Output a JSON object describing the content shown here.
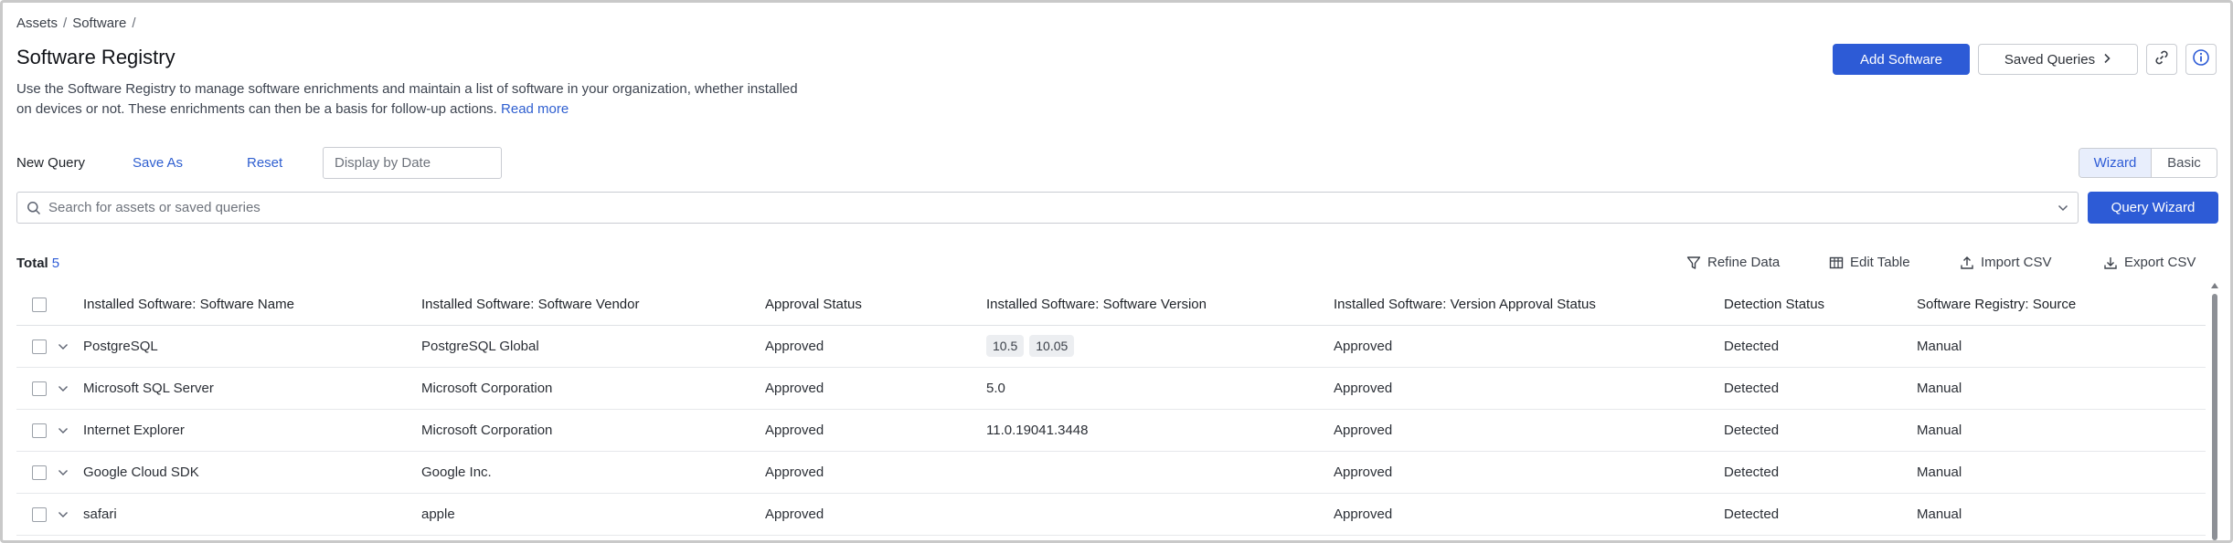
{
  "breadcrumb": {
    "items": [
      "Assets",
      "Software"
    ],
    "separator": "/"
  },
  "page": {
    "title": "Software Registry",
    "description": "Use the Software Registry to manage software enrichments and maintain a list of software in your organization, whether installed on devices or not. These enrichments can then be a basis for follow-up actions.",
    "read_more": "Read more"
  },
  "header_actions": {
    "add_software": "Add Software",
    "saved_queries": "Saved Queries",
    "link_icon": "link-icon",
    "info_icon": "info-icon"
  },
  "query_bar": {
    "new_query": "New Query",
    "save_as": "Save As",
    "reset": "Reset",
    "date_placeholder": "Display by Date",
    "mode_wizard": "Wizard",
    "mode_basic": "Basic",
    "active_mode": "Wizard"
  },
  "search": {
    "placeholder": "Search for assets or saved queries",
    "query_wizard": "Query Wizard"
  },
  "results": {
    "total_label": "Total",
    "total_count": "5"
  },
  "toolbar": {
    "refine_data": "Refine Data",
    "edit_table": "Edit Table",
    "import_csv": "Import CSV",
    "export_csv": "Export CSV"
  },
  "table": {
    "columns": [
      "Installed Software: Software Name",
      "Installed Software: Software Vendor",
      "Approval Status",
      "Installed Software: Software Version",
      "Installed Software: Version Approval Status",
      "Detection Status",
      "Software Registry: Source"
    ],
    "rows": [
      {
        "name": "PostgreSQL",
        "vendor": "PostgreSQL Global",
        "approval": "Approved",
        "versions": [
          "10.5",
          "10.05"
        ],
        "version_text": "",
        "version_approval": "Approved",
        "detection": "Detected",
        "source": "Manual"
      },
      {
        "name": "Microsoft SQL Server",
        "vendor": "Microsoft Corporation",
        "approval": "Approved",
        "versions": [],
        "version_text": "5.0",
        "version_approval": "Approved",
        "detection": "Detected",
        "source": "Manual"
      },
      {
        "name": "Internet Explorer",
        "vendor": "Microsoft Corporation",
        "approval": "Approved",
        "versions": [],
        "version_text": "11.0.19041.3448",
        "version_approval": "Approved",
        "detection": "Detected",
        "source": "Manual"
      },
      {
        "name": "Google Cloud SDK",
        "vendor": "Google Inc.",
        "approval": "Approved",
        "versions": [],
        "version_text": "",
        "version_approval": "Approved",
        "detection": "Detected",
        "source": "Manual"
      },
      {
        "name": "safari",
        "vendor": "apple",
        "approval": "Approved",
        "versions": [],
        "version_text": "",
        "version_approval": "Approved",
        "detection": "Detected",
        "source": "Manual"
      }
    ]
  },
  "colors": {
    "accent": "#2d5bd6",
    "link": "#2f5fd0",
    "border": "#c9ccd2"
  }
}
